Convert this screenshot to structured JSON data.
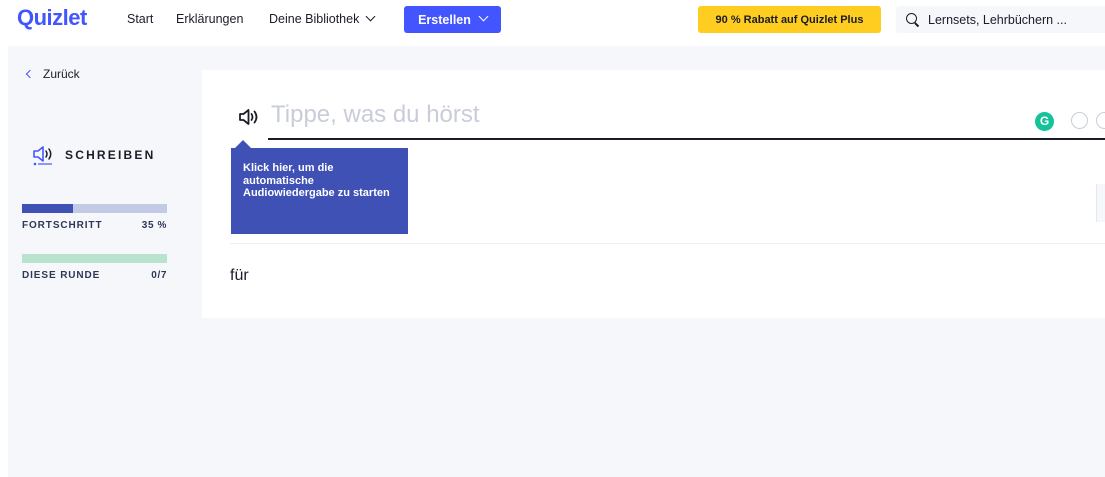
{
  "nav": {
    "logo": "Quizlet",
    "start": "Start",
    "explanations": "Erklärungen",
    "library": "Deine Bibliothek",
    "create": "Erstellen",
    "promo": "90 % Rabatt auf Quizlet Plus",
    "search_placeholder": "Lernsets, Lehrbüchern ..."
  },
  "sidebar": {
    "back": "Zurück",
    "mode": "SCHREIBEN",
    "progress_label": "FORTSCHRITT",
    "progress_value": "35 %",
    "progress_fraction": 0.35,
    "round_label": "DIESE RUNDE",
    "round_value": "0/7",
    "round_fraction": 0
  },
  "main": {
    "answer_placeholder": "Tippe, was du hörst",
    "tooltip": "Klick hier, um die automatische Audiowiedergabe zu starten",
    "prompt_word": "für"
  },
  "colors": {
    "brand": "#4255ff",
    "promo": "#ffcd1f",
    "progress": "#3f51b5",
    "round": "#b9e3cf"
  }
}
